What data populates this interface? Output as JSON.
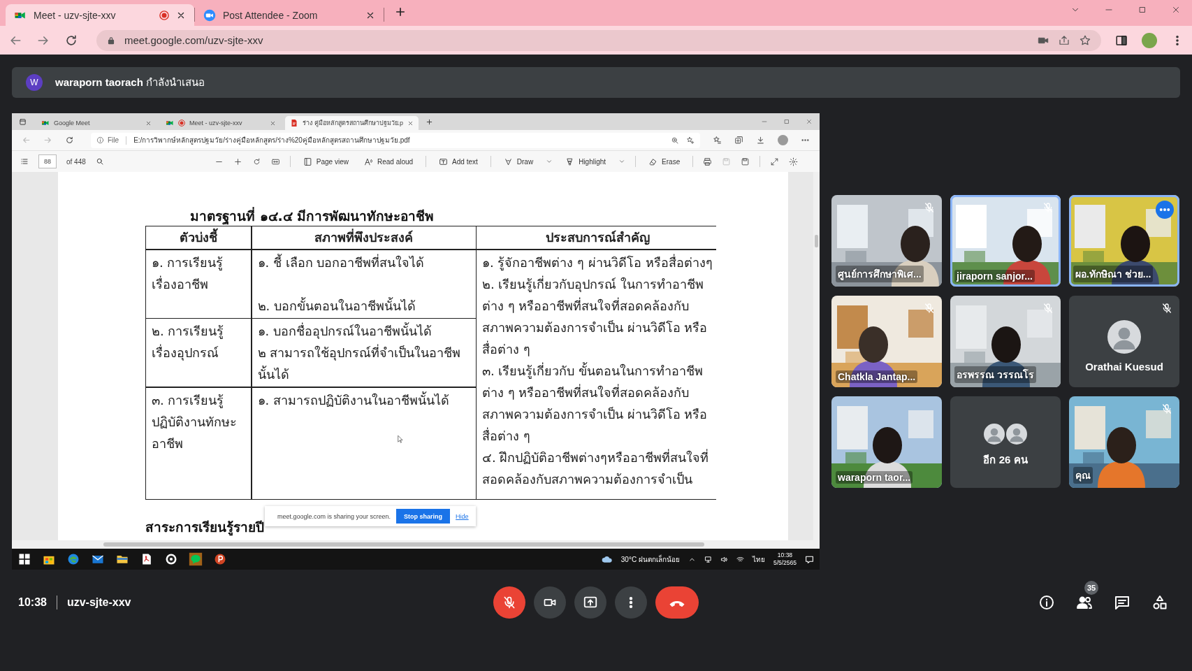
{
  "browser": {
    "tabs": [
      {
        "kind": "meet",
        "title": "Meet - uzv-sjte-xxv",
        "selected": true,
        "recording": true
      },
      {
        "kind": "zoom",
        "title": "Post Attendee - Zoom",
        "selected": false,
        "recording": false
      }
    ],
    "url": "meet.google.com/uzv-sjte-xxv"
  },
  "presenter_bar": {
    "initial": "W",
    "text": "**waraporn taorach** กำลังนำเสนอ"
  },
  "shared_screen": {
    "tabs": [
      {
        "kind": "meet",
        "title": "Google Meet",
        "selected": false,
        "recording": false
      },
      {
        "kind": "meet",
        "title": "Meet - uzv-sjte-xxv",
        "selected": false,
        "recording": true
      },
      {
        "kind": "pdf",
        "title": "ร่าง คู่มือหลักสูตรสถานศึกษาปฐมวัย.p",
        "selected": true,
        "recording": false
      }
    ],
    "address": {
      "scheme": "File",
      "path": "E:/การวิพากษ์หลักสูตรปฐมวัย/ร่างคู่มือหลักสูตร/ร่าง%20คู่มือหลักสูตรสถานศึกษาปฐมวัย.pdf"
    },
    "pdf_toolbar": {
      "page": "88",
      "page_count": "of 448",
      "tools": [
        {
          "kind": "page_view",
          "label": "Page view"
        },
        {
          "kind": "read_aloud",
          "label": "Read aloud"
        },
        {
          "kind": "add_text",
          "label": "Add text"
        },
        {
          "kind": "draw",
          "label": "Draw"
        },
        {
          "kind": "highlight",
          "label": "Highlight"
        },
        {
          "kind": "erase",
          "label": "Erase"
        }
      ]
    },
    "document": {
      "heading": "มาตรฐานที่ ๑๔.๔  มีการพัฒนาทักษะอาชีพ",
      "table": {
        "columns": [
          "ตัวบ่งชี้",
          "สภาพที่พึงประสงค์",
          "ประสบการณ์สำคัญ"
        ],
        "rows": [
          {
            "indicator": "๑. การเรียนรู้เรื่องอาชีพ",
            "outcomes": [
              "๑. ชี้ เลือก บอกอาชีพที่สนใจได้",
              "๒. บอกขั้นตอนในอาชีพนั้นได้"
            ]
          },
          {
            "indicator": "๒. การเรียนรู้เรื่องอุปกรณ์",
            "outcomes": [
              "๑. บอกชื่ออุปกรณ์ในอาชีพนั้นได้",
              "๒ สามารถใช้อุปกรณ์ที่จำเป็นในอาชีพนั้นได้"
            ]
          },
          {
            "indicator": "๓. การเรียนรู้ปฏิบัติงานทักษะอาชีพ",
            "outcomes": [
              "๑. สามารถปฏิบัติงานในอาชีพนั้นได้"
            ]
          }
        ],
        "experiences": [
          "๑. รู้จักอาชีพต่าง ๆ ผ่านวิดีโอ หรือสื่อต่างๆ",
          "๒. เรียนรู้เกี่ยวกับอุปกรณ์ ในการทำอาชีพต่าง ๆ หรืออาชีพที่สนใจที่สอดคล้องกับสภาพความต้องการจำเป็น ผ่านวิดีโอ หรือสื่อต่าง ๆ",
          "๓. เรียนรู้เกี่ยวกับ ขั้นตอนในการทำอาชีพต่าง ๆ หรืออาชีพที่สนใจที่สอดคล้องกับสภาพความต้องการจำเป็น ผ่านวิดีโอ หรือสื่อต่าง ๆ",
          "๔. ฝึกปฏิบัติอาชีพต่างๆหรืออาชีพที่สนใจที่สอดคล้องกับสภาพความต้องการจำเป็น"
        ]
      },
      "section_heading": "สาระการเรียนรู้รายปี"
    },
    "share_notice": {
      "message": "meet.google.com is sharing your screen.",
      "stop_button": "Stop sharing",
      "hide_link": "Hide"
    },
    "taskbar": {
      "weather": "30°C ฝนตกเล็กน้อย",
      "language": "ไทย",
      "time": "10:38",
      "date": "5/5/2565"
    }
  },
  "participants": [
    {
      "kind": "video",
      "name": "ศูนย์การศึกษาพิเศ...",
      "muted": true,
      "highlighted": false,
      "options_shown": false
    },
    {
      "kind": "video",
      "name": "jiraporn sanjor...",
      "muted": true,
      "highlighted": true,
      "options_shown": false
    },
    {
      "kind": "video",
      "name": "ผอ.ทักษิณา ช่วย...",
      "muted": false,
      "highlighted": true,
      "options_shown": true
    },
    {
      "kind": "video",
      "name": "Chatkla Jantap...",
      "muted": true,
      "highlighted": false,
      "options_shown": false
    },
    {
      "kind": "video",
      "name": "อรพรรณ วรรณโร",
      "muted": true,
      "highlighted": false,
      "options_shown": false
    },
    {
      "kind": "avatar",
      "name": "Orathai Kuesud",
      "muted": true,
      "highlighted": false,
      "options_shown": false
    },
    {
      "kind": "video",
      "name": "waraporn taor...",
      "muted": false,
      "highlighted": false,
      "options_shown": false
    },
    {
      "kind": "overflow",
      "name": "อีก 26 คน",
      "muted": false,
      "highlighted": false,
      "options_shown": false
    },
    {
      "kind": "video",
      "name": "คุณ",
      "muted": true,
      "highlighted": false,
      "options_shown": false
    }
  ],
  "call_bar": {
    "time": "10:38",
    "meeting_code": "uzv-sjte-xxv",
    "mic_on": false,
    "people_count": "35"
  }
}
